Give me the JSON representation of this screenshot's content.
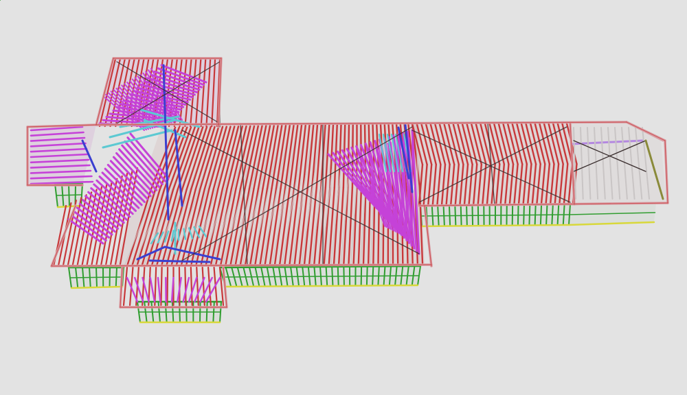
{
  "scene": {
    "background": "#e3e3e3",
    "description_shown": "",
    "colors": {
      "rafter_red": "#c8383a",
      "top_plate_pink": "#d9a0a6",
      "hip_truss_magenta": "#c542d8",
      "jack_truss_cyan": "#5cc9d2",
      "girder_blue": "#3a3fd0",
      "wall_frame_green": "#2f9d2f",
      "wall_frame_yellow": "#d8d83a",
      "dark_brace": "#3a2e2e",
      "lilac_member": "#b488e0",
      "light_gray_member": "#c9c5c5",
      "olive_member": "#8a8a3a"
    }
  }
}
